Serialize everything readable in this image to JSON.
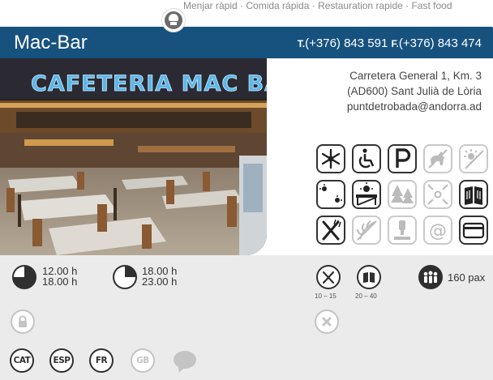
{
  "category": {
    "icon": "chef-hat-icon",
    "text": "Menjar ràpid · Comida rápida · Restauration rapide · Fast food"
  },
  "header": {
    "name": "Mac-Bar",
    "tel_label": "T.",
    "tel": "(+376) 843 591",
    "fax_label": "F.",
    "fax": "(+376) 843 474",
    "background": "#17527f"
  },
  "photo": {
    "sign_text": "CAFETERIA MAC BAR"
  },
  "address": {
    "line1": "Carretera General 1, Km. 3",
    "line2": "(AD600) Sant Julià de Lòria",
    "email": "puntdetrobada@andorra.ad"
  },
  "services": [
    {
      "icon": "air-conditioning-icon",
      "enabled": true
    },
    {
      "icon": "wheelchair-icon",
      "enabled": true
    },
    {
      "icon": "parking-icon",
      "enabled": true
    },
    {
      "icon": "pets-icon",
      "enabled": false
    },
    {
      "icon": "heating-icon",
      "enabled": false
    },
    {
      "icon": "lighting-icon",
      "enabled": true
    },
    {
      "icon": "terrace-icon",
      "enabled": true
    },
    {
      "icon": "garden-icon",
      "enabled": false
    },
    {
      "icon": "fullscreen-icon",
      "enabled": false
    },
    {
      "icon": "menu-book-icon",
      "enabled": true
    },
    {
      "icon": "cutlery-icon",
      "enabled": true
    },
    {
      "icon": "vegetarian-icon",
      "enabled": false
    },
    {
      "icon": "vending-icon",
      "enabled": false
    },
    {
      "icon": "email-icon",
      "enabled": false
    },
    {
      "icon": "credit-card-icon",
      "enabled": true
    }
  ],
  "hours": [
    {
      "open": "12.00 h",
      "close": "18.00 h"
    },
    {
      "open": "18.00 h",
      "close": "23.00 h"
    }
  ],
  "prices": {
    "carta": {
      "icon": "cutlery-icon",
      "min": "10",
      "max": "15"
    },
    "menu": {
      "icon": "menu-book-icon",
      "min": "20",
      "max": "40"
    }
  },
  "capacity": {
    "icon": "group-icon",
    "value": "160 pax"
  },
  "status_icons": [
    {
      "icon": "lock-icon",
      "enabled": false
    },
    {
      "icon": "close-icon",
      "enabled": false
    }
  ],
  "languages": [
    {
      "code": "CAT",
      "enabled": true
    },
    {
      "code": "ESP",
      "enabled": true
    },
    {
      "code": "FR",
      "enabled": true
    },
    {
      "code": "GB",
      "enabled": false
    },
    {
      "code": "",
      "icon": "speech-bubble-icon",
      "enabled": false
    }
  ]
}
